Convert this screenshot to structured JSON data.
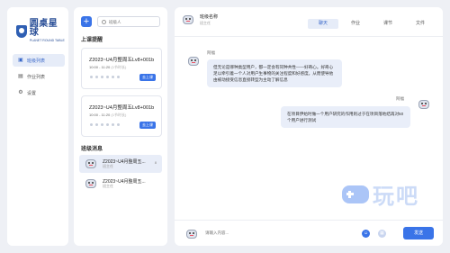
{
  "brand": {
    "name_cn": "圆桌星球",
    "name_en": "PLANET ROUND TABLE"
  },
  "nav": {
    "items": [
      {
        "label": "班级列表",
        "icon": "users-icon",
        "active": true
      },
      {
        "label": "作业列表",
        "icon": "clipboard-icon",
        "active": false
      },
      {
        "label": "设置",
        "icon": "gear-icon",
        "active": false
      }
    ]
  },
  "middle": {
    "add_label": "+",
    "search_placeholder": "班级人",
    "reminder_title": "上课提醒",
    "cards": [
      {
        "title": "Z2023~U4月整周五Lv8+001b",
        "time": "10:00 - 11:20",
        "time_note": "(1节时长)",
        "button": "去上课"
      },
      {
        "title": "Z2023~U4月整周五Lv8+001b",
        "time": "10:00 - 11:20",
        "time_note": "(1节时长)",
        "button": "去上课"
      }
    ],
    "messages_title": "班级消息",
    "messages": [
      {
        "name": "Z2023~U4月整周五...",
        "sub": "班主任",
        "badge": "8",
        "active": true
      },
      {
        "name": "Z2023~U4月整周五...",
        "sub": "班主任",
        "badge": "",
        "active": false
      }
    ]
  },
  "chat": {
    "header_name": "班级名称",
    "header_sub": "班主任",
    "tabs": [
      {
        "label": "聊天",
        "active": true
      },
      {
        "label": "作业",
        "active": false
      },
      {
        "label": "课节",
        "active": false
      },
      {
        "label": "文件",
        "active": false
      }
    ],
    "messages": [
      {
        "sender": "阿福",
        "text": "但无论是哪种类型用户，都一定会有同种共性——好奇心。好奇心足以牵引着一个人对用户生事物的关注程度和好感度。从而使导他由被动接受信息直接转型为主动了解信息"
      },
      {
        "sender": "阿福",
        "text": "在项目伊始时做一个用户研究的作用则过于在项目落地结再对50个用户进行测试"
      }
    ],
    "input_placeholder": "请输入内容...",
    "send_label": "发送"
  },
  "watermark": {
    "text": "玩吧"
  },
  "colors": {
    "accent": "#3a74e8",
    "nav_active_bg": "#e6ecf8",
    "bubble_bg": "#e9eef9",
    "page_bg": "#eef0f5"
  }
}
